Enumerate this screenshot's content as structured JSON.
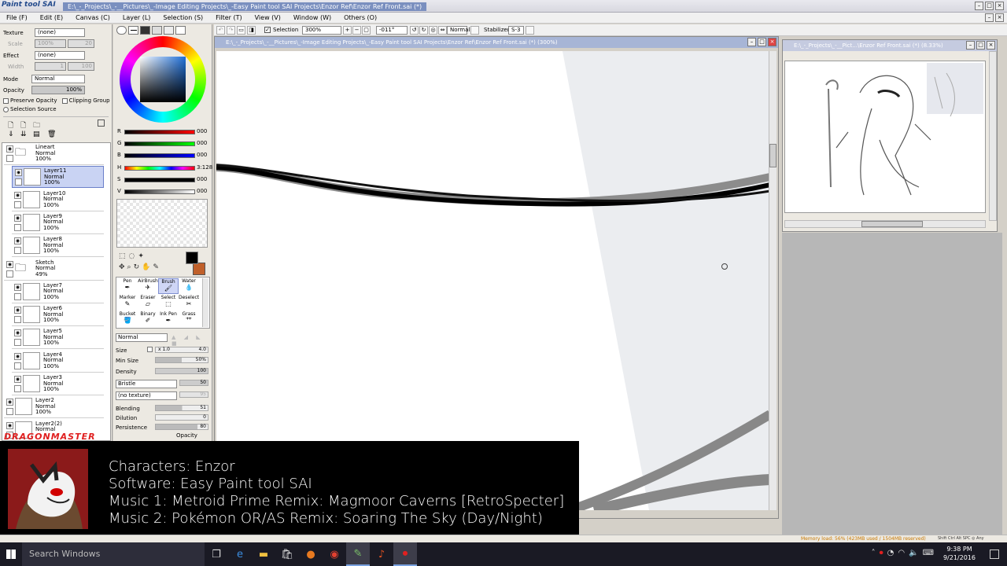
{
  "app": {
    "logo_text": "Paint tool SAI",
    "title": "E:\\_-_Projects\\_-__Pictures\\_-Image Editing Projects\\_-Easy Paint tool SAI Projects\\Enzor Ref\\Enzor Ref Front.sai (*)"
  },
  "menu": [
    "File (F)",
    "Edit (E)",
    "Canvas (C)",
    "Layer (L)",
    "Selection (S)",
    "Filter (T)",
    "View (V)",
    "Window (W)",
    "Others (O)"
  ],
  "texture": {
    "label": "Texture",
    "value": "(none)",
    "scale_label": "Scale",
    "scale_value": "100%",
    "scale_num": "20"
  },
  "effect": {
    "label": "Effect",
    "value": "(none)",
    "width_label": "Width",
    "width_num": "1",
    "width_val": "100"
  },
  "mode": {
    "label": "Mode",
    "value": "Normal"
  },
  "opacity": {
    "label": "Opacity",
    "value": "100%"
  },
  "checks": {
    "preserve": "Preserve Opacity",
    "clipping": "Clipping Group",
    "selsrc": "Selection Source"
  },
  "layers": [
    {
      "name": "Lineart",
      "mode": "Normal",
      "opacity": "100%",
      "folder": true
    },
    {
      "name": "Layer11",
      "mode": "Normal",
      "opacity": "100%",
      "selected": true
    },
    {
      "name": "Layer10",
      "mode": "Normal",
      "opacity": "100%"
    },
    {
      "name": "Layer9",
      "mode": "Normal",
      "opacity": "100%"
    },
    {
      "name": "Layer8",
      "mode": "Normal",
      "opacity": "100%"
    },
    {
      "name": "Sketch",
      "mode": "Normal",
      "opacity": "49%",
      "folder": true
    },
    {
      "name": "Layer7",
      "mode": "Normal",
      "opacity": "100%"
    },
    {
      "name": "Layer6",
      "mode": "Normal",
      "opacity": "100%"
    },
    {
      "name": "Layer5",
      "mode": "Normal",
      "opacity": "100%"
    },
    {
      "name": "Layer4",
      "mode": "Normal",
      "opacity": "100%"
    },
    {
      "name": "Layer3",
      "mode": "Normal",
      "opacity": "100%"
    },
    {
      "name": "Layer2",
      "mode": "Normal",
      "opacity": "100%"
    },
    {
      "name": "Layer2(2)",
      "mode": "Normal",
      "opacity": ""
    }
  ],
  "color": {
    "r_label": "R",
    "r": "000",
    "g_label": "G",
    "g": "000",
    "b_label": "B",
    "b": "000",
    "h_label": "H",
    "h": "3:128",
    "s_label": "S",
    "s": "000",
    "v_label": "V",
    "v": "000",
    "primary": "#000000",
    "secondary": "#c0602a"
  },
  "tools": [
    {
      "name": "Pen",
      "icon": "pen-icon"
    },
    {
      "name": "AirBrush",
      "icon": "airbrush-icon"
    },
    {
      "name": "Brush",
      "icon": "brush-icon",
      "selected": true
    },
    {
      "name": "Water",
      "icon": "water-icon"
    },
    {
      "name": "Marker",
      "icon": "marker-icon"
    },
    {
      "name": "Eraser",
      "icon": "eraser-icon"
    },
    {
      "name": "Select",
      "icon": "select-icon"
    },
    {
      "name": "Deselect",
      "icon": "deselect-icon"
    },
    {
      "name": "Bucket",
      "icon": "bucket-icon"
    },
    {
      "name": "Binary",
      "icon": "binary-icon"
    },
    {
      "name": "Ink Pen",
      "icon": "inkpen-icon"
    },
    {
      "name": "Grass",
      "icon": "grass-icon"
    }
  ],
  "brush": {
    "mode": "Normal",
    "size_label": "Size",
    "size_mult": "x 1.0",
    "size": "4.0",
    "minsize_label": "Min Size",
    "minsize": "50%",
    "density_label": "Density",
    "density": "100",
    "shape": "Bristle",
    "shape_val": "50",
    "texture": "(no texture)",
    "texture_val": "95",
    "blending_label": "Blending",
    "blending": "51",
    "dilution_label": "Dilution",
    "dilution": "0",
    "persistence_label": "Persistence",
    "persistence": "80",
    "keep_opacity": "Opacity"
  },
  "toolbar": {
    "selection": "Selection",
    "zoom": "300%",
    "angle": "-011°",
    "mode": "Normal",
    "stabilizer_label": "Stabilizer",
    "stabilizer": "S-3"
  },
  "canvas_title": "E:\\_-_Projects\\_-__Pictures\\_-Image Editing Projects\\_-Easy Paint tool SAI Projects\\Enzor Ref\\Enzor Ref Front.sai (*) (300%)",
  "nav_title": "E:\\_-_Projects\\_-__Pict...\\Enzor Ref Front.sai (*) (8.33%)",
  "brand": "DRAGONMASTER",
  "overlay": {
    "line1": "Characters: Enzor",
    "line2": "Software: Easy Paint tool SAI",
    "line3": "Music 1: Metroid Prime Remix: Magmoor Caverns [RetroSpecter]",
    "line4": "Music 2: Pokémon OR/AS Remix: Soaring The Sky (Day/Night)"
  },
  "status": "Memory load: 56% (423MB used / 1504MB reserved)",
  "status_keys": "Shift Ctrl Alt SPC ◎ Any",
  "taskbar": {
    "search": "Search Windows",
    "time": "9:38 PM",
    "date": "9/21/2016"
  }
}
